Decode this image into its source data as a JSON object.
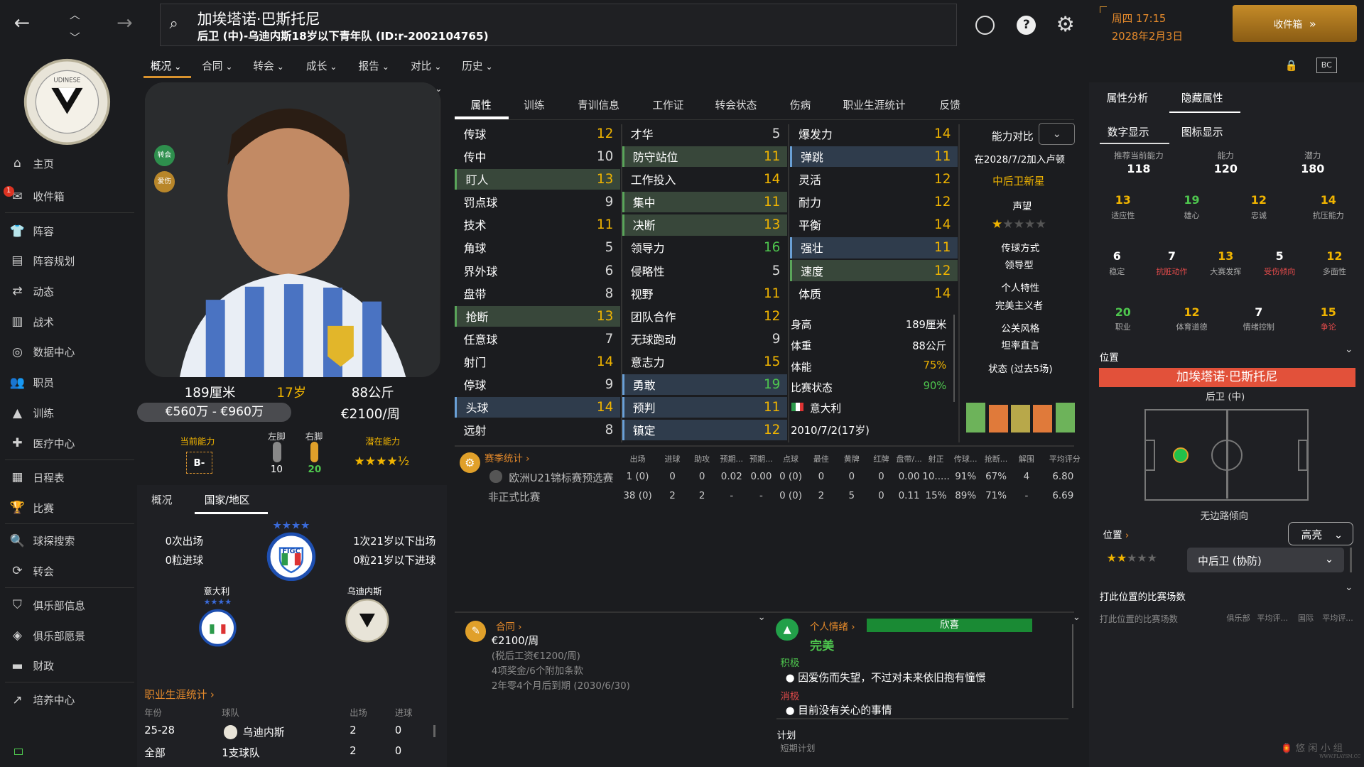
{
  "nav": {
    "back": "←",
    "forward": "→"
  },
  "player": {
    "name": "加埃塔诺·巴斯托尼",
    "subtitle": "后卫 (中)-乌迪内斯18岁以下青年队 (ID:r-2002104765)",
    "height": "189厘米",
    "age": "17岁",
    "weight": "88公斤",
    "value": "€560万 - €960万",
    "wage": "€2100/周",
    "badges": [
      "转会",
      "爱伤"
    ],
    "current_ability_label": "当前能力",
    "current_ability": "B-",
    "left_foot_label": "左脚",
    "left_foot": "10",
    "right_foot_label": "右脚",
    "right_foot": "20",
    "potential_label": "潜在能力",
    "potential_stars": "★★★★½"
  },
  "header": {
    "date_day": "周四 17:15",
    "date": "2028年2月3日",
    "inbox_button": "收件箱"
  },
  "menu": [
    "概况",
    "合同",
    "转会",
    "成长",
    "报告",
    "对比",
    "历史"
  ],
  "sidebar": [
    {
      "label": "主页",
      "icon": "home-icon",
      "glyph": "⌂"
    },
    {
      "label": "收件箱",
      "icon": "inbox-icon",
      "glyph": "✉",
      "badge": "1"
    },
    {
      "label": "阵容",
      "icon": "shirt-icon",
      "glyph": "👕"
    },
    {
      "label": "阵容规划",
      "icon": "clipboard-icon",
      "glyph": "▤"
    },
    {
      "label": "动态",
      "icon": "dynamics-icon",
      "glyph": "⇄"
    },
    {
      "label": "战术",
      "icon": "tactics-icon",
      "glyph": "▥"
    },
    {
      "label": "数据中心",
      "icon": "data-icon",
      "glyph": "◎"
    },
    {
      "label": "职员",
      "icon": "staff-icon",
      "glyph": "👥"
    },
    {
      "label": "训练",
      "icon": "training-icon",
      "glyph": "▲"
    },
    {
      "label": "医疗中心",
      "icon": "medical-icon",
      "glyph": "✚"
    },
    {
      "label": "日程表",
      "icon": "calendar-icon",
      "glyph": "▦"
    },
    {
      "label": "比赛",
      "icon": "trophy-icon",
      "glyph": "🏆"
    },
    {
      "label": "球探搜索",
      "icon": "search-icon",
      "glyph": "🔍"
    },
    {
      "label": "转会",
      "icon": "transfer-icon",
      "glyph": "⟳"
    },
    {
      "label": "俱乐部信息",
      "icon": "shield-icon",
      "glyph": "⛉"
    },
    {
      "label": "俱乐部愿景",
      "icon": "vision-icon",
      "glyph": "◈"
    },
    {
      "label": "财政",
      "icon": "finance-icon",
      "glyph": "▬"
    },
    {
      "label": "培养中心",
      "icon": "development-icon",
      "glyph": "↗"
    }
  ],
  "tabs": [
    "属性",
    "训练",
    "青训信息",
    "工作证",
    "转会状态",
    "伤病",
    "职业生涯统计",
    "反馈"
  ],
  "attributes": {
    "col1": [
      [
        "传球",
        "12"
      ],
      [
        "传中",
        "10"
      ],
      [
        "盯人",
        "13"
      ],
      [
        "罚点球",
        "9"
      ],
      [
        "技术",
        "11"
      ],
      [
        "角球",
        "5"
      ],
      [
        "界外球",
        "6"
      ],
      [
        "盘带",
        "8"
      ],
      [
        "抢断",
        "13"
      ],
      [
        "任意球",
        "7"
      ],
      [
        "射门",
        "14"
      ],
      [
        "停球",
        "9"
      ],
      [
        "头球",
        "14"
      ],
      [
        "远射",
        "8"
      ]
    ],
    "col2": [
      [
        "才华",
        "5"
      ],
      [
        "防守站位",
        "11"
      ],
      [
        "工作投入",
        "14"
      ],
      [
        "集中",
        "11"
      ],
      [
        "决断",
        "13"
      ],
      [
        "领导力",
        "16"
      ],
      [
        "侵略性",
        "5"
      ],
      [
        "视野",
        "11"
      ],
      [
        "团队合作",
        "12"
      ],
      [
        "无球跑动",
        "9"
      ],
      [
        "意志力",
        "15"
      ],
      [
        "勇敢",
        "19"
      ],
      [
        "预判",
        "11"
      ],
      [
        "镇定",
        "12"
      ]
    ],
    "col3": [
      [
        "爆发力",
        "14"
      ],
      [
        "弹跳",
        "11"
      ],
      [
        "灵活",
        "12"
      ],
      [
        "耐力",
        "12"
      ],
      [
        "平衡",
        "14"
      ],
      [
        "强壮",
        "11"
      ],
      [
        "速度",
        "12"
      ],
      [
        "体质",
        "14"
      ]
    ],
    "physical": [
      [
        "身高",
        "189厘米"
      ],
      [
        "体重",
        "88公斤"
      ],
      [
        "体能",
        "75%"
      ],
      [
        "比赛状态",
        "90%"
      ]
    ],
    "nation": "意大利",
    "dob": "2010/7/2(17岁)"
  },
  "comparison": {
    "title": "能力对比",
    "joined": "在2028/7/2加入卢顿",
    "tag": "中后卫新星",
    "reputation_label": "声望",
    "reputation_stars": "★★★★★",
    "style_label": "传球方式",
    "style": "领导型",
    "trait_label": "个人特性",
    "trait": "完美主义者",
    "media_label": "公关风格",
    "media": "坦率直言",
    "form_label": "状态 (过去5场)",
    "form_bars": [
      {
        "h": 0.6,
        "c": "#6db35a"
      },
      {
        "h": 0.55,
        "c": "#e07a3a"
      },
      {
        "h": 0.55,
        "c": "#b8a84a"
      },
      {
        "h": 0.55,
        "c": "#e07a3a"
      },
      {
        "h": 0.6,
        "c": "#6db35a"
      }
    ]
  },
  "season": {
    "title": "赛季统计",
    "headers": [
      "出场",
      "进球",
      "助攻",
      "预期...",
      "预期...",
      "点球",
      "最佳",
      "黄牌",
      "红牌",
      "盘带/...",
      "射正",
      "传球...",
      "抢断...",
      "解围",
      "平均评分"
    ],
    "rows": [
      {
        "name": "欧洲U21锦标赛预选赛",
        "vals": [
          "1 (0)",
          "0",
          "0",
          "0.02",
          "0.00",
          "0 (0)",
          "0",
          "0",
          "0",
          "0.00",
          "10.....",
          "91%",
          "67%",
          "4",
          "6.80"
        ]
      },
      {
        "name": "非正式比赛",
        "vals": [
          "38 (0)",
          "2",
          "2",
          "-",
          "-",
          "0 (0)",
          "2",
          "5",
          "0",
          "0.11",
          "15%",
          "89%",
          "71%",
          "-",
          "6.69"
        ]
      }
    ]
  },
  "contract": {
    "title": "合同",
    "wage": "€2100/周",
    "tax": "(税后工资€1200/周)",
    "bonus": "4项奖金/6个附加条款",
    "expiry": "2年零4个月后到期 (2030/6/30)"
  },
  "morale": {
    "title": "个人情绪",
    "bar": "欣喜",
    "state": "完美",
    "pos_label": "积极",
    "pos": "因爱伤而失望，不过对未来依旧抱有憧憬",
    "neg_label": "消极",
    "neg": "目前没有关心的事情",
    "plan_label": "计划",
    "plan": "短期计划"
  },
  "left_bottom": {
    "tab1": "概况",
    "tab2": "国家/地区",
    "caps": "0次出场",
    "goals": "0粒进球",
    "u21_caps": "1次21岁以下出场",
    "u21_goals": "0粒21岁以下进球",
    "nation": "意大利",
    "club": "乌迪内斯",
    "fed": "FIGC",
    "career_title": "职业生涯统计",
    "career_headers": [
      "年份",
      "球队",
      "出场",
      "进球"
    ],
    "career_rows": [
      [
        "25-28",
        "乌迪内斯",
        "2",
        "0"
      ],
      [
        "全部",
        "1支球队",
        "2",
        "0"
      ]
    ]
  },
  "right": {
    "tab1": "属性分析",
    "tab2": "隐藏属性",
    "sub1": "数字显示",
    "sub2": "图标显示",
    "ability_labels": [
      "推荐当前能力",
      "能力",
      "潜力"
    ],
    "ability_vals": [
      "118",
      "120",
      "180"
    ],
    "hidden": [
      [
        [
          "13",
          "适应性",
          "#f0b400",
          "#aaa"
        ],
        [
          "19",
          "雄心",
          "#4ec64e",
          "#aaa"
        ],
        [
          "12",
          "忠诚",
          "#f0b400",
          "#aaa"
        ],
        [
          "14",
          "抗压能力",
          "#f0b400",
          "#aaa"
        ]
      ],
      [
        [
          "6",
          "稳定",
          "#fff",
          "#aaa"
        ],
        [
          "7",
          "抗脏动作",
          "#fff",
          "#e14a4a"
        ],
        [
          "13",
          "大赛发挥",
          "#f0b400",
          "#aaa"
        ],
        [
          "5",
          "受伤倾向",
          "#fff",
          "#e14a4a"
        ],
        [
          "12",
          "多面性",
          "#f0b400",
          "#aaa"
        ]
      ],
      [
        [
          "20",
          "职业",
          "#4ec64e",
          "#aaa"
        ],
        [
          "12",
          "体育道德",
          "#f0b400",
          "#aaa"
        ],
        [
          "7",
          "情绪控制",
          "#fff",
          "#aaa"
        ],
        [
          "15",
          "争论",
          "#f0b400",
          "#e14a4a"
        ]
      ]
    ],
    "pos_label": "位置",
    "pos_name": "加埃塔诺·巴斯托尼",
    "pos_role": "后卫 (中)",
    "pos_foot": "无边路倾向",
    "pos2_label": "位置",
    "highlight": "高亮",
    "role_select": "中后卫 (协防)",
    "role_stars": "★★★★★",
    "matches_title": "打此位置的比赛场数",
    "matches_sub": "打此位置的比赛场数",
    "matches_cols": [
      "俱乐部",
      "平均评...",
      "国际",
      "平均评..."
    ]
  },
  "watermark": "悠 闲 小 组"
}
